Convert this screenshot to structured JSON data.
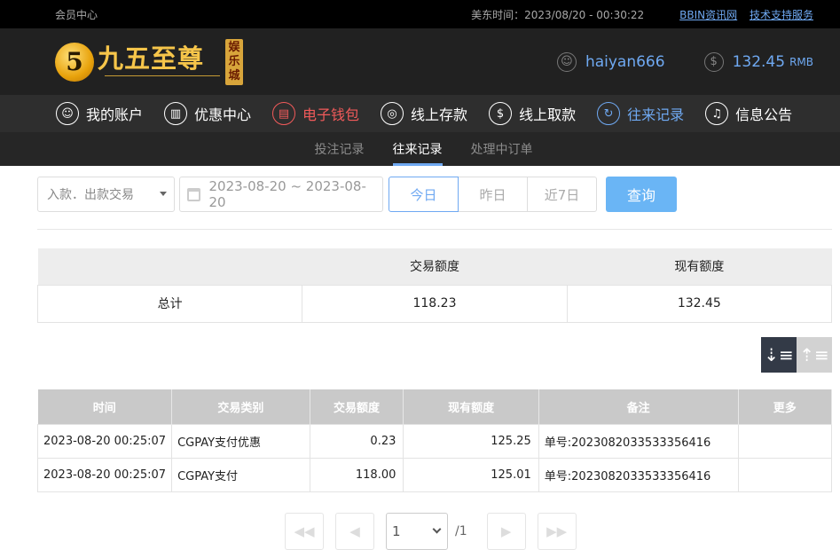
{
  "topbar": {
    "title": "会员中心",
    "clock": "美东时间：2023/08/20 - 00:30:22",
    "links": [
      "BBIN资讯网",
      "技术支持服务"
    ]
  },
  "header": {
    "logo": {
      "badge": "5",
      "main": "九五至尊",
      "tag": "娱乐城"
    },
    "username": "haiyan666",
    "balance": "132.45",
    "currency": "RMB"
  },
  "nav": [
    {
      "label": "我的账户",
      "icon": "user-icon",
      "glyph": "☺"
    },
    {
      "label": "优惠中心",
      "icon": "gift-icon",
      "glyph": "▥"
    },
    {
      "label": "电子钱包",
      "icon": "wallet-icon",
      "glyph": "▤"
    },
    {
      "label": "线上存款",
      "icon": "deposit-icon",
      "glyph": "◎"
    },
    {
      "label": "线上取款",
      "icon": "withdraw-icon",
      "glyph": "$"
    },
    {
      "label": "往来记录",
      "icon": "records-icon",
      "glyph": "↻"
    },
    {
      "label": "信息公告",
      "icon": "bell-icon",
      "glyph": "♫"
    }
  ],
  "subnav": [
    "投注记录",
    "往来记录",
    "处理中订单"
  ],
  "filters": {
    "type": "入款．出款交易",
    "date_range": "2023-08-20 ~ 2023-08-20",
    "quick": [
      "今日",
      "昨日",
      "近7日"
    ],
    "query": "查询"
  },
  "summary": {
    "headers": [
      "",
      "交易额度",
      "现有额度"
    ],
    "row": [
      "总计",
      "118.23",
      "132.45"
    ]
  },
  "table": {
    "headers": [
      "时间",
      "交易类别",
      "交易额度",
      "现有额度",
      "备注",
      "更多"
    ],
    "rows": [
      [
        "2023-08-20 00:25:07",
        "CGPAY支付优惠",
        "0.23",
        "125.25",
        "单号:2023082033533356416",
        ""
      ],
      [
        "2023-08-20 00:25:07",
        "CGPAY支付",
        "118.00",
        "125.01",
        "单号:2023082033533356416",
        ""
      ]
    ]
  },
  "pager": {
    "page": "1",
    "total": "/1"
  },
  "colors": {
    "accent": "#6fa9f2",
    "danger": "#f15a5a",
    "query": "#6ab5f5"
  }
}
